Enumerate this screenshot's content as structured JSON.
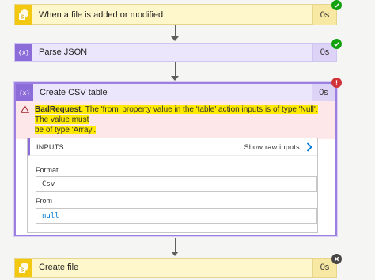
{
  "colors": {
    "trigger_accent": "#f2c811",
    "action_accent": "#8c6cd9",
    "success": "#13a10e",
    "error": "#d13438",
    "skipped": "#484644",
    "error_bg": "#fde7e9",
    "highlight": "#ffea00"
  },
  "steps": {
    "trigger": {
      "title": "When a file is added or modified",
      "duration": "0s",
      "icon": "sharepoint-icon",
      "status": "success"
    },
    "parse_json": {
      "title": "Parse JSON",
      "duration": "0s",
      "icon": "data-operation-icon",
      "status": "success"
    },
    "create_csv": {
      "title": "Create CSV table",
      "duration": "0s",
      "icon": "data-operation-icon",
      "status": "failed",
      "error": {
        "code": "BadRequest",
        "message_line1": ". The 'from' property value in the 'table' action inputs is of type 'Null'. The value must",
        "message_line2": "be of type 'Array'."
      },
      "inputs": {
        "header": "INPUTS",
        "show_raw": "Show raw inputs",
        "format_label": "Format",
        "format_value": "Csv",
        "from_label": "From",
        "from_value": "null"
      }
    },
    "create_file": {
      "title": "Create file",
      "duration": "0s",
      "icon": "sharepoint-icon",
      "status": "skipped"
    }
  }
}
